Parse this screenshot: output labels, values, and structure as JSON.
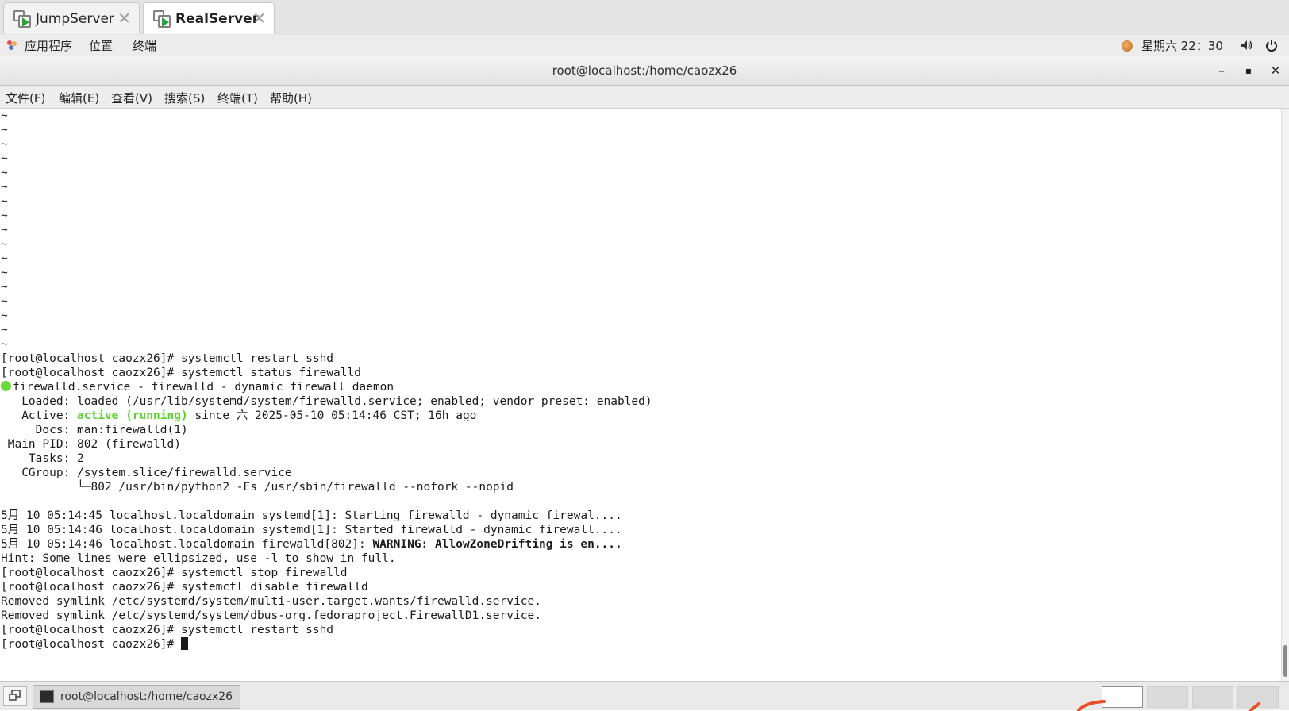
{
  "tabs": [
    {
      "label": "JumpServer",
      "active": false
    },
    {
      "label": "RealServer",
      "active": true
    }
  ],
  "panel": {
    "applications": "应用程序",
    "places": "位置",
    "terminal": "终端",
    "clock": "星期六 22：30"
  },
  "window": {
    "title": "root@localhost:/home/caozx26"
  },
  "menubar": {
    "file": "文件(F)",
    "edit": "编辑(E)",
    "view": "查看(V)",
    "search": "搜索(S)",
    "terminal": "终端(T)",
    "help": "帮助(H)"
  },
  "terminal": {
    "tilde": "~",
    "lines": {
      "l0": "[root@localhost caozx26]# systemctl restart sshd",
      "l1": "[root@localhost caozx26]# systemctl status firewalld",
      "l2": "firewalld.service - firewalld - dynamic firewall daemon",
      "l3": "   Loaded: loaded (/usr/lib/systemd/system/firewalld.service; enabled; vendor preset: enabled)",
      "l4a": "   Active: ",
      "l4b": "active (running)",
      "l4c": " since 六 2025-05-10 05:14:46 CST; 16h ago",
      "l5": "     Docs: man:firewalld(1)",
      "l6": " Main PID: 802 (firewalld)",
      "l7": "    Tasks: 2",
      "l8": "   CGroup: /system.slice/firewalld.service",
      "l9": "           └─802 /usr/bin/python2 -Es /usr/sbin/firewalld --nofork --nopid",
      "l10": "5月 10 05:14:45 localhost.localdomain systemd[1]: Starting firewalld - dynamic firewal....",
      "l11": "5月 10 05:14:46 localhost.localdomain systemd[1]: Started firewalld - dynamic firewall....",
      "l12a": "5月 10 05:14:46 localhost.localdomain firewalld[802]: ",
      "l12b": "WARNING: AllowZoneDrifting is en....",
      "l13": "Hint: Some lines were ellipsized, use -l to show in full.",
      "l14": "[root@localhost caozx26]# systemctl stop firewalld",
      "l15": "[root@localhost caozx26]# systemctl disable firewalld",
      "l16": "Removed symlink /etc/systemd/system/multi-user.target.wants/firewalld.service.",
      "l17": "Removed symlink /etc/systemd/system/dbus-org.fedoraproject.FirewallD1.service.",
      "l18": "[root@localhost caozx26]# systemctl restart sshd",
      "l19": "[root@localhost caozx26]# "
    }
  },
  "taskbar": {
    "window_label": "root@localhost:/home/caozx26"
  },
  "colors": {
    "active_status": "#5ad330",
    "play_icon": "#2aa436"
  }
}
